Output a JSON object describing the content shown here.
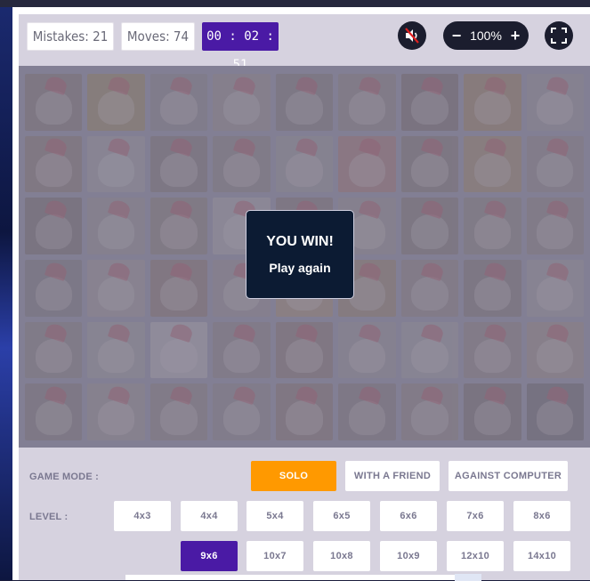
{
  "toolbar": {
    "mistakes": "Mistakes: 21",
    "moves": "Moves: 74",
    "timer": "00 : 02 : 51",
    "zoom": {
      "minus": "−",
      "value": "100%",
      "plus": "+"
    }
  },
  "board": {
    "rows": 6,
    "cols": 9,
    "card_colors": [
      "#7f6a5a",
      "#a0833e",
      "#8a7f78",
      "#9a8c80",
      "#7b6d62",
      "#8b7d70",
      "#6f5a4e",
      "#a3783c",
      "#9c9490",
      "#8a6f5c",
      "#a6a19b",
      "#7d6b60",
      "#8a7a6e",
      "#9b9590",
      "#b06a5a",
      "#7d6a5c",
      "#a6824a",
      "#8e7f77",
      "#6e5d50",
      "#9a8f86",
      "#8a7562",
      "#b3aca8",
      "#7e6c60",
      "#9c8f85",
      "#7c6a5c",
      "#8a7a6a",
      "#8b7d70",
      "#7a6f68",
      "#a6988e",
      "#8d6a58",
      "#9a8d85",
      "#b08a5a",
      "#9a7a4e",
      "#8e7c70",
      "#7d6b5f",
      "#a59c95",
      "#8a7b70",
      "#a59f96",
      "#c2bbb5",
      "#8d7d72",
      "#8a6c5a",
      "#9d948c",
      "#a59e99",
      "#8f7d70",
      "#a28d76",
      "#7e7064",
      "#a09488",
      "#8b7a6e",
      "#8d8078",
      "#8a6c5c",
      "#7e6e66",
      "#8e7d70",
      "#6f5e52",
      "#605652"
    ]
  },
  "win": {
    "title": "YOU WIN!",
    "action": "Play again"
  },
  "settings": {
    "game_mode_label": "GAME MODE :",
    "modes": [
      "SOLO",
      "WITH A FRIEND",
      "AGAINST COMPUTER"
    ],
    "selected_mode": "SOLO",
    "level_label": "LEVEL :",
    "levels": [
      "4x3",
      "4x4",
      "5x4",
      "6x5",
      "6x6",
      "7x6",
      "8x6",
      "9x6",
      "10x7",
      "10x8",
      "10x9",
      "12x10",
      "14x10"
    ],
    "selected_level": "9x6"
  }
}
